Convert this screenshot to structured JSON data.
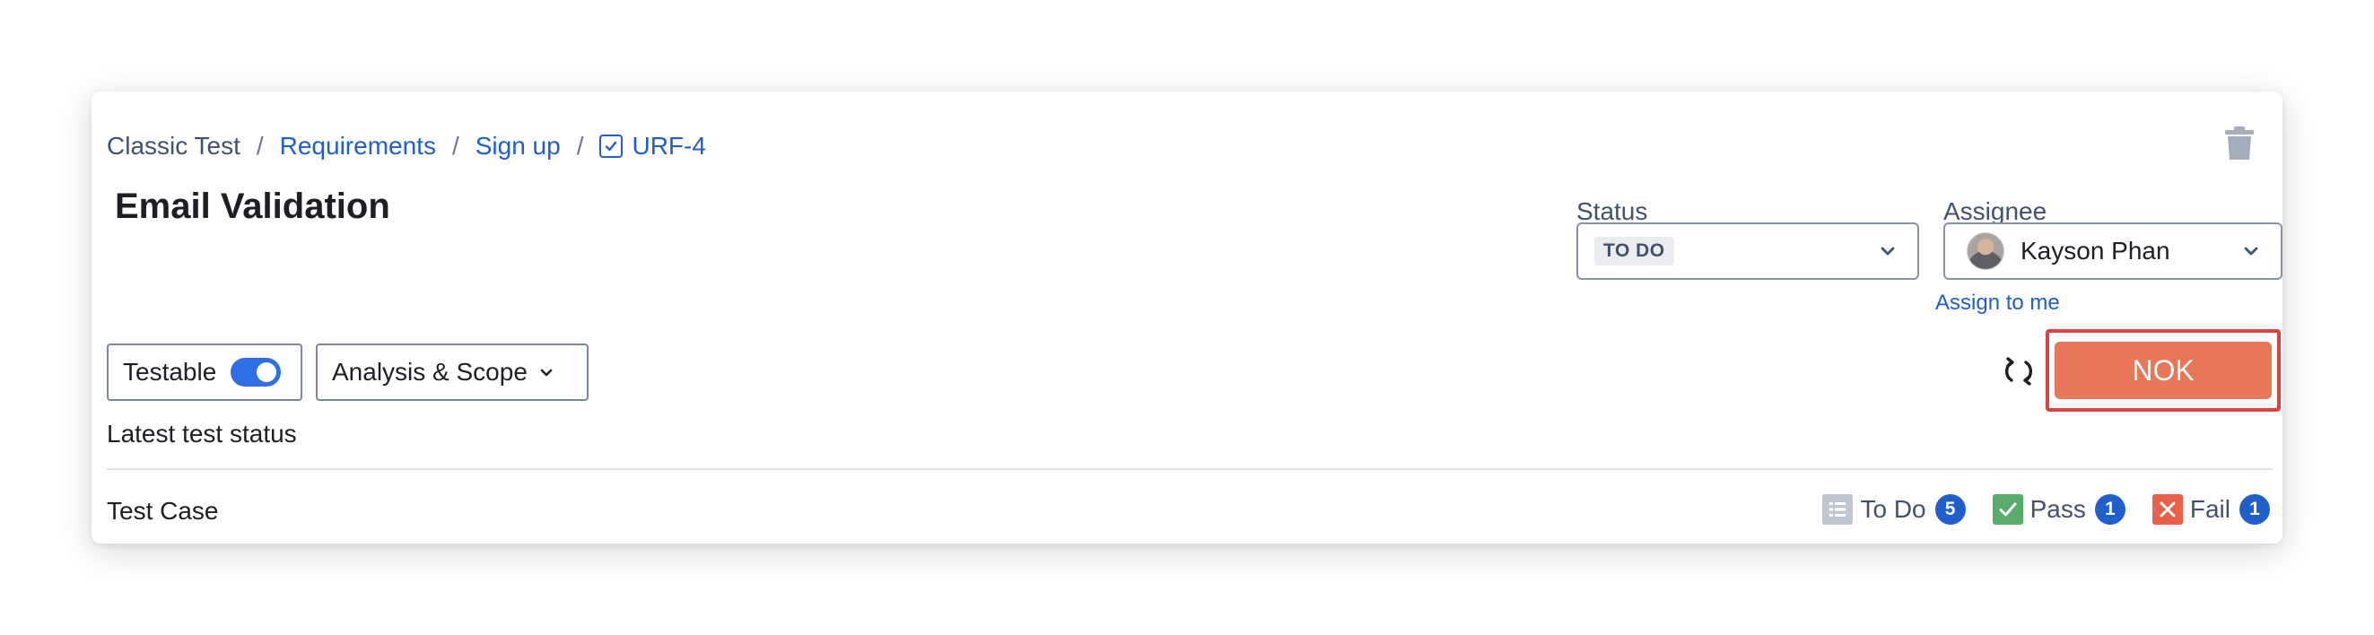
{
  "breadcrumb": {
    "project": "Classic Test",
    "section": "Requirements",
    "page": "Sign up",
    "issue_key": "URF-4",
    "separator": "/"
  },
  "issue": {
    "title": "Email Validation"
  },
  "status": {
    "label": "Status",
    "value": "TO DO"
  },
  "assignee": {
    "label": "Assignee",
    "name": "Kayson Phan",
    "assign_to_me": "Assign to me"
  },
  "toolbar": {
    "testable_label": "Testable",
    "testable_on": true,
    "scope_label": "Analysis & Scope",
    "result_button": "NOK"
  },
  "test_status": {
    "heading": "Latest test status",
    "row_label": "Test Case",
    "summary": [
      {
        "label": "To Do",
        "count": "5",
        "icon": "list-icon",
        "color": "#c1c7d0"
      },
      {
        "label": "Pass",
        "count": "1",
        "icon": "check-icon",
        "color": "#5aac6a"
      },
      {
        "label": "Fail",
        "count": "1",
        "icon": "x-icon",
        "color": "#e8604a"
      }
    ]
  },
  "colors": {
    "link": "#1f5fcc",
    "nok": "#e8775a",
    "highlight": "#e0403f",
    "toggle": "#2f6fe4"
  }
}
